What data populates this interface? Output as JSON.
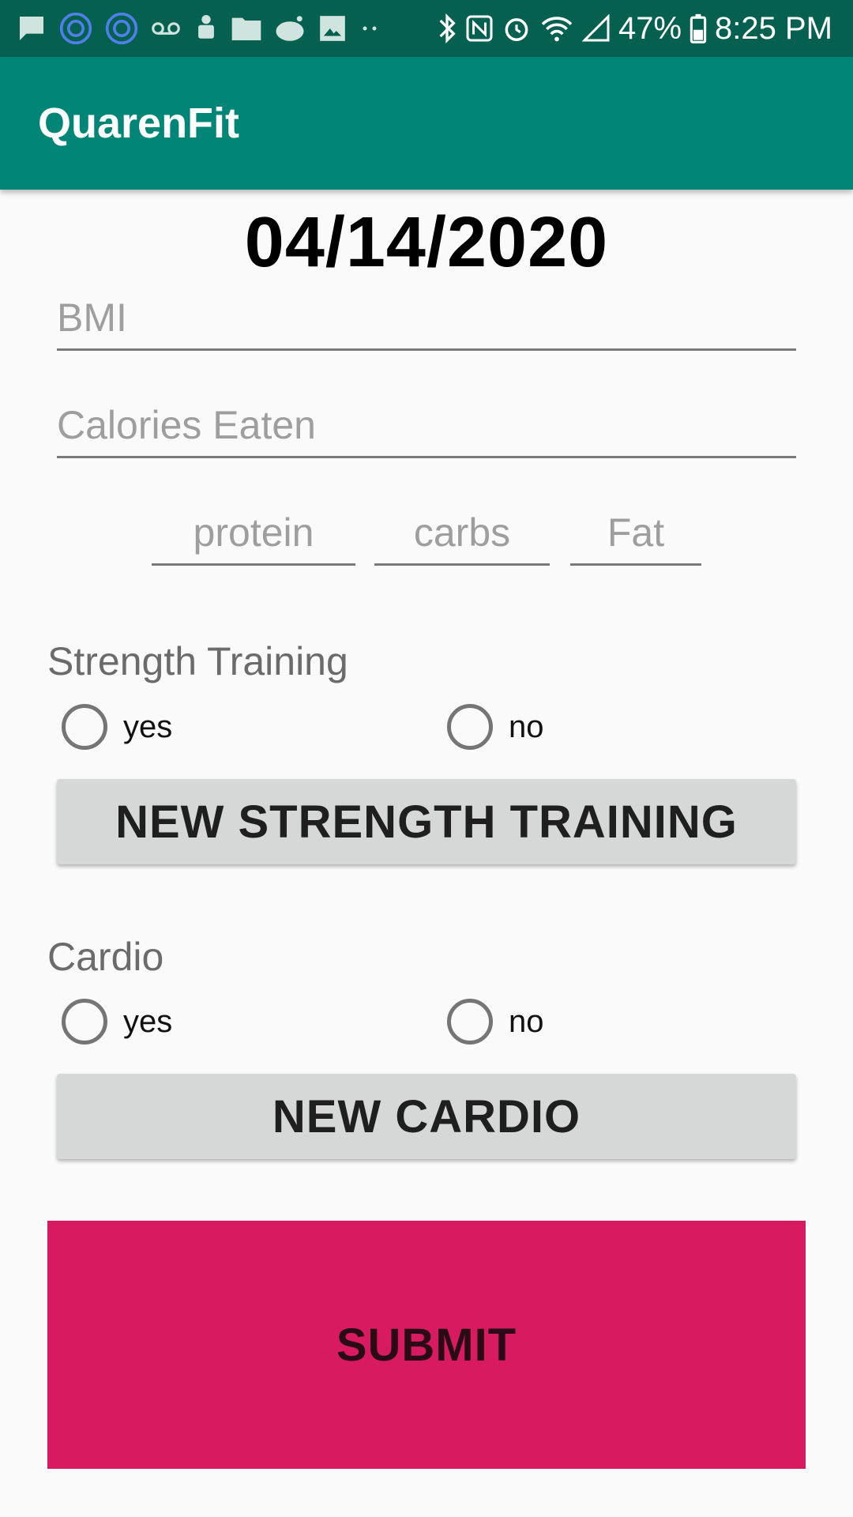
{
  "status_bar": {
    "left_icons": [
      "message-icon",
      "at-sign-icon",
      "at-sign-icon",
      "voicemail-icon",
      "android-icon",
      "folder-icon",
      "reddit-icon",
      "image-icon",
      "more-dots-icon"
    ],
    "right_icons": [
      "bluetooth-icon",
      "nfc-icon",
      "alarm-icon",
      "wifi-icon",
      "signal-icon"
    ],
    "battery_percent": "47%",
    "time": "8:25 PM"
  },
  "app_bar": {
    "title": "QuarenFit"
  },
  "date": "04/14/2020",
  "fields": {
    "bmi_placeholder": "BMI",
    "calories_placeholder": "Calories Eaten",
    "protein_placeholder": "protein",
    "carbs_placeholder": "carbs",
    "fat_placeholder": "Fat"
  },
  "strength": {
    "label": "Strength Training",
    "yes": "yes",
    "no": "no",
    "button": "NEW STRENGTH TRAINING"
  },
  "cardio": {
    "label": "Cardio",
    "yes": "yes",
    "no": "no",
    "button": "NEW CARDIO"
  },
  "submit": "SUBMIT",
  "colors": {
    "status_bar": "#05604f",
    "app_bar": "#008577",
    "submit": "#d81b60",
    "button_gray": "#d6d7d7"
  }
}
